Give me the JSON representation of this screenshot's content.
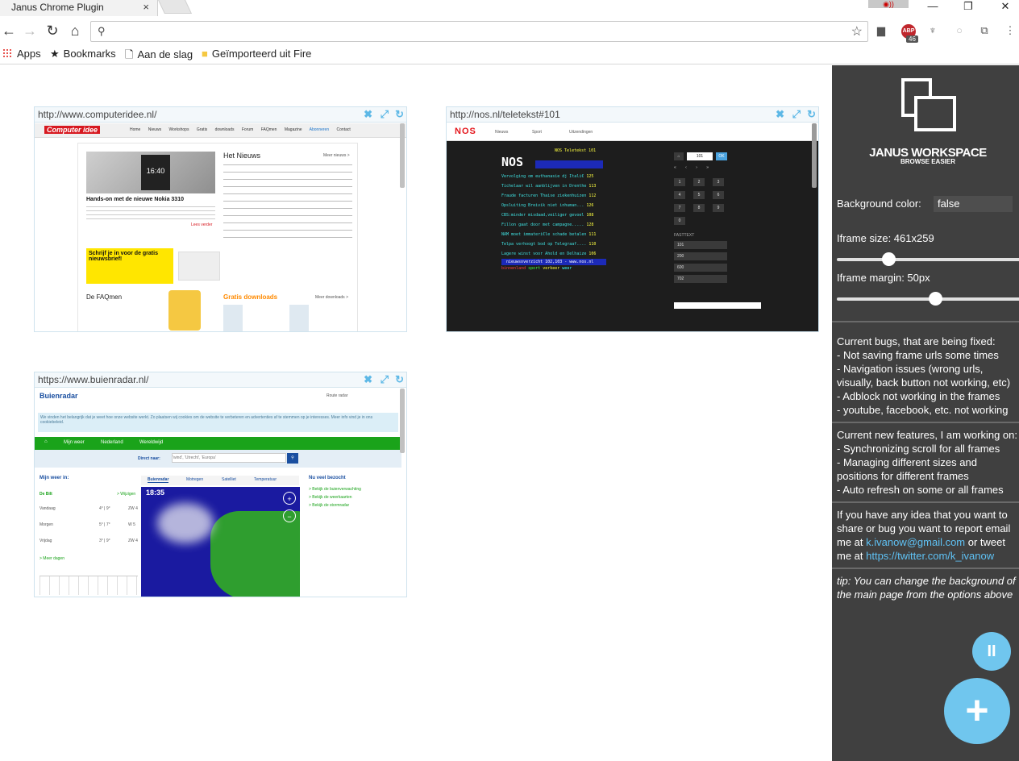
{
  "browser": {
    "tab_title": "Janus Chrome Plugin",
    "tab_close": "×",
    "address_value": "",
    "minimize": "—",
    "restore": "❐",
    "close": "✕",
    "abp_label": "ABP",
    "abp_count": "46"
  },
  "bookmarks": [
    {
      "label": "Apps"
    },
    {
      "label": "Bookmarks"
    },
    {
      "label": "Aan de slag"
    },
    {
      "label": "Geïmporteerd uit Fire"
    }
  ],
  "frames": [
    {
      "url": "http://www.computeridee.nl/"
    },
    {
      "url": "http://nos.nl/teletekst#101"
    },
    {
      "url": "https://www.buienradar.nl/"
    }
  ],
  "frame1": {
    "logo": "Computer idee",
    "nav": [
      "Home",
      "Nieuws",
      "Workshops",
      "Gratis downloads",
      "Forum",
      "FAQmen",
      "Magazine",
      "Abonneren",
      "Contact"
    ],
    "headline": "Hands-on met de nieuwe Nokia 3310",
    "news_title": "Het Nieuws",
    "more_news": "Meer nieuws >",
    "news_items": [
      "Eenvoudig uw email-adres verbergen",
      "Samsung Galaxy S8 officieel gepresenteerd",
      "Wees voorzichtig met kinderfoto's online",
      "Microsoft stopt met ondersteuning Vista",
      "Nieuwe functies in Google Maps",
      "Onderzoek: Nederlanders online veiliger",
      "Firefox krijgt nieuwe functie",
      "Nieuwe tablets gespot",
      "Update voor WhatsApp",
      "Privacyinstellingen gewijzigd"
    ],
    "promo": "Schrijf je in voor de gratis nieuwsbrief!",
    "faq": "De FAQmen",
    "downloads": "Gratis downloads",
    "more_downloads": "Meer downloads >",
    "read_more": "Lees verder"
  },
  "frame2": {
    "logo": "NOS",
    "nav": [
      "Nieuws",
      "Sport",
      "Uitzendingen"
    ],
    "page": "101",
    "ok": "OK",
    "header": "NOS Teletekst 101",
    "lines": [
      {
        "text": "Vervolging om euthanasie dj Itali€",
        "num": "125"
      },
      {
        "text": "Tichelaar wil aanblijven in Drenthe",
        "num": "113"
      },
      {
        "text": "Fraude facturen Thaise ziekenhuizen",
        "num": "112"
      },
      {
        "text": "Opsluiting Breivik niet inhuman...",
        "num": "126"
      },
      {
        "text": "CBS:minder misdaad,veiliger gevoel",
        "num": "108"
      },
      {
        "text": "Fillon gaat door met campagne.....",
        "num": "128"
      },
      {
        "text": "NAM moet immateri€le schade betalen",
        "num": "111"
      },
      {
        "text": "Telpa verhoogt bod op Telegraaf....",
        "num": "110"
      },
      {
        "text": "Lagere winst voor Ahold en Delhaize",
        "num": "106"
      }
    ],
    "footer": "nieuwsoverzicht 102,103 - www.nos.nl",
    "footer_links": [
      "binnenland",
      "sport",
      "verkeer",
      "weer"
    ],
    "keys": [
      "1",
      "2",
      "3",
      "4",
      "5",
      "6",
      "7",
      "8",
      "9",
      "0"
    ],
    "side_label": "FASTTEXT",
    "side_values": [
      "101",
      "200",
      "600",
      "702"
    ]
  },
  "frame3": {
    "logo": "Buienradar",
    "routes": "Route radar",
    "notice": "We vinden het belangrijk dat je weet hoe onze website werkt. Zo plaatsen wij cookies om de website te verbeteren en advertenties af te stemmen op je interesses. Meer info vind je in ons cookiebeleid.",
    "nav": [
      "Mijn weer",
      "Nederland",
      "Wereldwijd"
    ],
    "search_label": "Direct naar:",
    "search_placeholder": "'wind', 'Utrecht', 'Europa'",
    "my_weather": "Mijn weer in:",
    "place": "De Bilt",
    "change": "> Wijzigen",
    "days": [
      {
        "day": "Vandaag",
        "temp": "4° | 9°",
        "wind": "ZW 4"
      },
      {
        "day": "Morgen",
        "temp": "5° | 7°",
        "wind": "W 5"
      },
      {
        "day": "Vrijdag",
        "temp": "3° | 9°",
        "wind": "ZW 4"
      }
    ],
    "more_days": "> Meer dagen",
    "tabs": [
      "Buienradar",
      "Motregen",
      "Satelliet",
      "Temperatuur"
    ],
    "time": "18:35",
    "most_visited": "Nu veel bezocht",
    "links": [
      "> Bekijk de buienverwachting",
      "> Bekijk de weerkaarten",
      "> Bekijk de stormradar"
    ]
  },
  "sidebar": {
    "brand": "JANUS WORKSPACE",
    "tagline": "BROWSE EASIER",
    "bg_label": "Background color:",
    "bg_value": "false",
    "size_label": "Iframe size: 461x259",
    "size_value": 0.28,
    "margin_label": "Iframe margin: 50px",
    "margin_value": 0.53,
    "bugs_title": "Current bugs, that are being fixed:",
    "bugs": [
      "- Not saving frame urls some times",
      "- Navigation issues (wrong urls, visually, back button not working, etc)",
      "- Adblock not working in the frames",
      "- youtube, facebook, etc. not working"
    ],
    "features_title": "Current new features, I am working on:",
    "features": [
      "- Synchronizing scroll for all frames",
      "- Managing different sizes and positions for different frames",
      "- Auto refresh on some or all frames"
    ],
    "contact_pre": "If you have any idea that you want to share or bug you want to report email me at ",
    "email": "k.ivanow@gmail.com",
    "contact_mid": " or tweet me at ",
    "twitter": "https://twitter.com/k_ivanow",
    "tip": "tip: You can change the background of the main page from the options above",
    "pause": "II",
    "add": "+"
  }
}
